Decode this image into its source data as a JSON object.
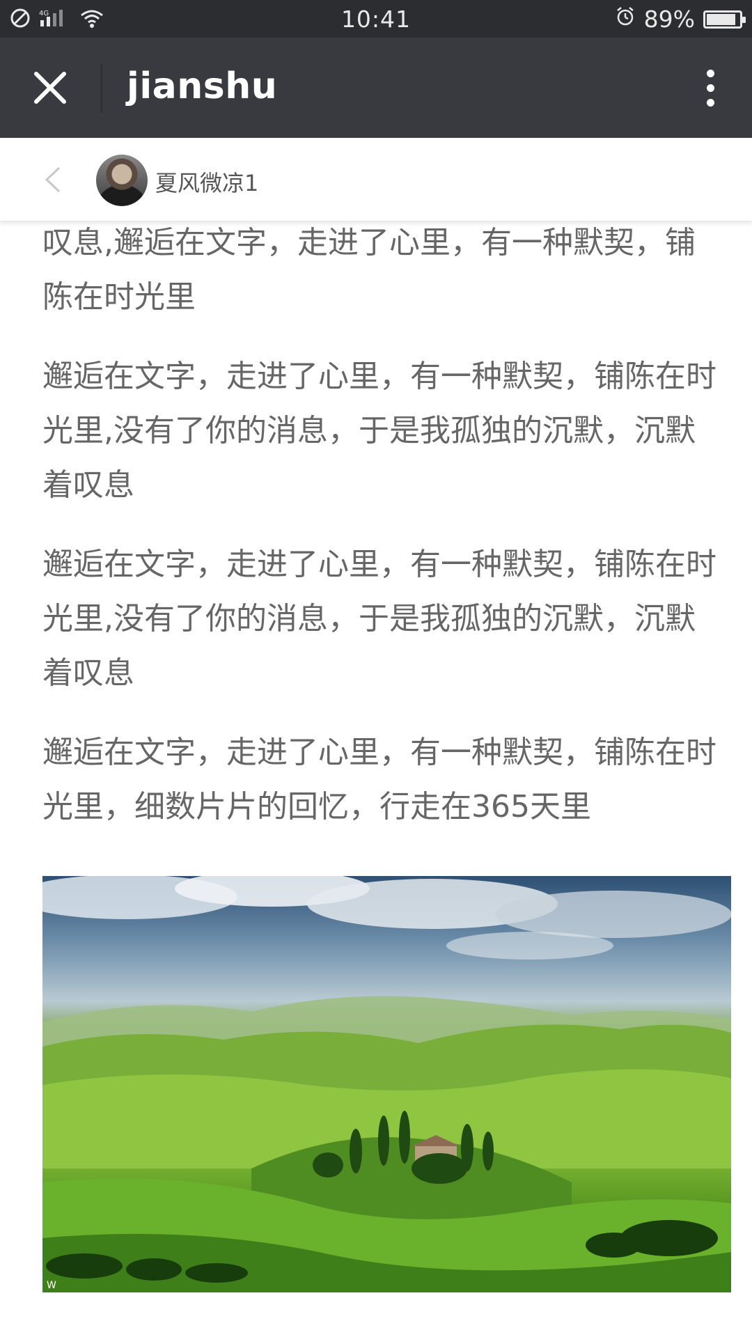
{
  "status_bar": {
    "time": "10:41",
    "battery_text": "89%",
    "battery_level": 0.89,
    "network_label": "4G",
    "icons": [
      "no-disturb-icon",
      "signal-icon",
      "wifi-icon",
      "alarm-icon",
      "battery-icon"
    ]
  },
  "title_bar": {
    "title": "jianshu",
    "close_icon": "close-icon",
    "more_icon": "more-vertical-icon"
  },
  "author": {
    "name": "夏风微凉1",
    "back_icon": "chevron-left-icon"
  },
  "article": {
    "paragraphs": [
      "叹息,邂逅在文字，走进了心里，有一种默契，铺陈在时光里",
      "邂逅在文字，走进了心里，有一种默契，铺陈在时光里,没有了你的消息，于是我孤独的沉默，沉默着叹息",
      "邂逅在文字，走进了心里，有一种默契，铺陈在时光里,没有了你的消息，于是我孤独的沉默，沉默着叹息",
      "邂逅在文字，走进了心里，有一种默契，铺陈在时光里，细数片片的回忆，行走在365天里"
    ]
  },
  "image": {
    "subject": "green rolling hills landscape under cloudy sky",
    "watermark": "W"
  },
  "colors": {
    "status_bar_bg": "#2b2d30",
    "title_bar_bg": "#393a3f",
    "body_text": "#666666",
    "author_text": "#555555"
  }
}
